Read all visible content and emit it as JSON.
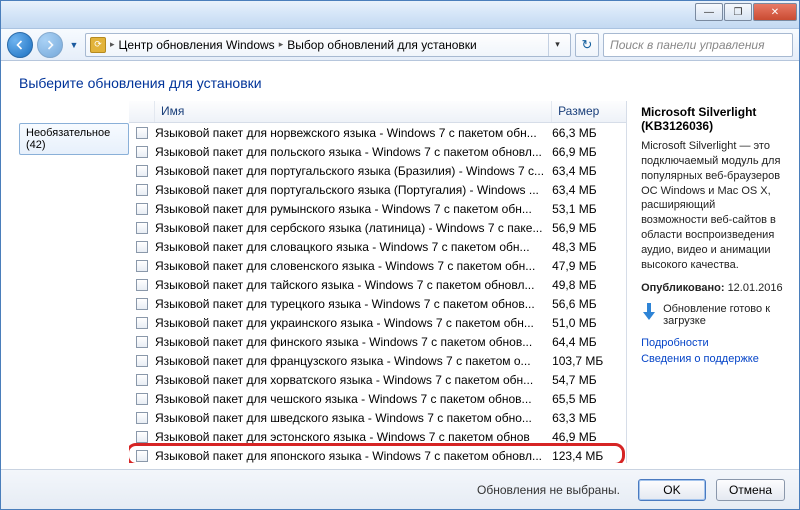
{
  "window_controls": {
    "min": "—",
    "max": "❐",
    "close": "✕"
  },
  "breadcrumb": {
    "seg1": "Центр обновления Windows",
    "seg2": "Выбор обновлений для установки"
  },
  "search": {
    "placeholder": "Поиск в панели управления"
  },
  "page_title": "Выберите обновления для установки",
  "category": {
    "label": "Необязательное (42)"
  },
  "columns": {
    "name": "Имя",
    "size": "Размер"
  },
  "updates": [
    {
      "name": "Языковой пакет для норвежского языка - Windows 7 с пакетом обн...",
      "size": "66,3 МБ"
    },
    {
      "name": "Языковой пакет для польского языка - Windows 7 с пакетом обновл...",
      "size": "66,9 МБ"
    },
    {
      "name": "Языковой пакет для португальского языка (Бразилия) - Windows 7 с...",
      "size": "63,4 МБ"
    },
    {
      "name": "Языковой пакет для португальского языка (Португалия) - Windows ...",
      "size": "63,4 МБ"
    },
    {
      "name": "Языковой пакет для румынского языка - Windows 7 с пакетом обн...",
      "size": "53,1 МБ"
    },
    {
      "name": "Языковой пакет для сербского языка (латиница) - Windows 7 с паке...",
      "size": "56,9 МБ"
    },
    {
      "name": "Языковой пакет для словацкого языка - Windows 7 с пакетом обн...",
      "size": "48,3 МБ"
    },
    {
      "name": "Языковой пакет для словенского языка - Windows 7 с пакетом обн...",
      "size": "47,9 МБ"
    },
    {
      "name": "Языковой пакет для тайского языка - Windows 7 с пакетом обновл...",
      "size": "49,8 МБ"
    },
    {
      "name": "Языковой пакет для турецкого языка - Windows 7 с пакетом обнов...",
      "size": "56,6 МБ"
    },
    {
      "name": "Языковой пакет для украинского языка - Windows 7 с пакетом обн...",
      "size": "51,0 МБ"
    },
    {
      "name": "Языковой пакет для финского языка - Windows 7 с пакетом обнов...",
      "size": "64,4 МБ"
    },
    {
      "name": "Языковой пакет для французского языка - Windows 7 с пакетом о...",
      "size": "103,7 МБ"
    },
    {
      "name": "Языковой пакет для хорватского языка - Windows 7 с пакетом обн...",
      "size": "54,7 МБ"
    },
    {
      "name": "Языковой пакет для чешского языка - Windows 7 с пакетом обнов...",
      "size": "65,5 МБ"
    },
    {
      "name": "Языковой пакет для шведского языка - Windows 7 с пакетом обно...",
      "size": "63,3 МБ"
    },
    {
      "name": "Языковой пакет для эстонского языка - Windows 7 с пакетом обнов",
      "size": "46,9 МБ"
    },
    {
      "name": "Языковой пакет для японского языка - Windows 7 с пакетом обновл...",
      "size": "123,4 МБ"
    }
  ],
  "details": {
    "title": "Microsoft Silverlight (KB3126036)",
    "desc": "Microsoft Silverlight — это подключаемый модуль для популярных веб-браузеров ОС Windows и Mac OS X, расширяющий возможности веб-сайтов в области воспроизведения аудио, видео и анимации высокого качества.",
    "published_label": "Опубликовано:",
    "published_value": "12.01.2016",
    "ready": "Обновление готово к загрузке",
    "link1": "Подробности",
    "link2": "Сведения о поддержке"
  },
  "bottom": {
    "status": "Обновления не выбраны.",
    "ok": "OK",
    "cancel": "Отмена"
  }
}
